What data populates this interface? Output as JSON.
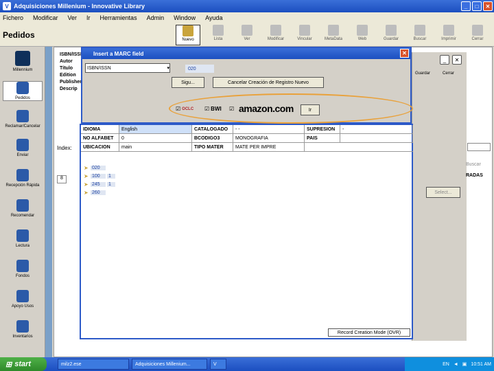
{
  "window": {
    "title": "Adquisiciones Millenium - Innovative Library"
  },
  "menu": [
    "Fichero",
    "Modificar",
    "Ver",
    "Ir",
    "Herramientas",
    "Admin",
    "Window",
    "Ayuda"
  ],
  "page_title": "Pedidos",
  "toolbar": [
    {
      "label": "Nuevo",
      "icon": "new-record-icon"
    },
    {
      "label": "Lista",
      "icon": "list-icon"
    },
    {
      "label": "Ver",
      "icon": "view-icon"
    },
    {
      "label": "Modificar",
      "icon": "modify-icon"
    },
    {
      "label": "Vincular",
      "icon": "link-icon"
    },
    {
      "label": "MetaData",
      "icon": "metadata-icon"
    },
    {
      "label": "Web",
      "icon": "web-icon"
    },
    {
      "label": "Guardar",
      "icon": "save-icon"
    },
    {
      "label": "Buscar",
      "icon": "search-icon"
    },
    {
      "label": "Imprimir",
      "icon": "print-icon"
    },
    {
      "label": "Cerrar",
      "icon": "close-doc-icon"
    }
  ],
  "sidebar": [
    {
      "label": "Millennium",
      "icon": "millennium-logo-icon"
    },
    {
      "label": "Pedidos",
      "icon": "orders-icon"
    },
    {
      "label": "Reclamar/Cancelar",
      "icon": "claim-icon"
    },
    {
      "label": "Enviar",
      "icon": "send-icon"
    },
    {
      "label": "Recepción Rápida",
      "icon": "receive-icon"
    },
    {
      "label": "Recomendar",
      "icon": "recommend-icon"
    },
    {
      "label": "Lectura",
      "icon": "reading-icon"
    },
    {
      "label": "Fondos",
      "icon": "funds-icon"
    },
    {
      "label": "Apoyo Usos",
      "icon": "support-icon"
    },
    {
      "label": "Inventarios",
      "icon": "inventory-icon"
    }
  ],
  "behind_labels": {
    "fields": [
      "ISBN/ISSN",
      "Autor",
      "Título",
      "Edition",
      "Publisher",
      "Descrip"
    ],
    "index_label": "Index:",
    "page_num": "8"
  },
  "dialog": {
    "title": "Insert a MARC field",
    "select_value": "ISBN/ISSN",
    "tag": "020",
    "button_next": "Sigu...",
    "button_cancel": "Cancelar Creación de Registro Nuevo",
    "sources": [
      "OCLC",
      "BWI",
      "amazon.com"
    ],
    "go_button": "Ir"
  },
  "record": {
    "rows": [
      [
        "IDIOMA",
        "English",
        "CATALOGADO",
        "- -",
        "SUPRESION",
        "-"
      ],
      [
        "NO ALFABET",
        "0",
        "BCODIGO3",
        "MONOGRAFIA",
        "PAIS",
        ""
      ],
      [
        "UBICACION",
        "main",
        "TIPO MATER",
        "MATE PER IMPRE",
        "",
        ""
      ]
    ],
    "marc": [
      {
        "tag": "020",
        "ind": ""
      },
      {
        "tag": "100",
        "ind": "1"
      },
      {
        "tag": "245",
        "ind": "1"
      },
      {
        "tag": "260",
        "ind": ""
      }
    ],
    "status": "Record Creation Mode (OVR)"
  },
  "right_panel": {
    "guardar": "Guardar",
    "cerrar": "Cerrar",
    "buscar": "Buscar",
    "radas": "RADAS",
    "select": "Select..."
  },
  "taskbar": {
    "start": "start",
    "tasks": [
      "milz2.ese",
      "Adquisiciones Millenium..."
    ],
    "lang": "EN",
    "time": "10:51 AM"
  }
}
